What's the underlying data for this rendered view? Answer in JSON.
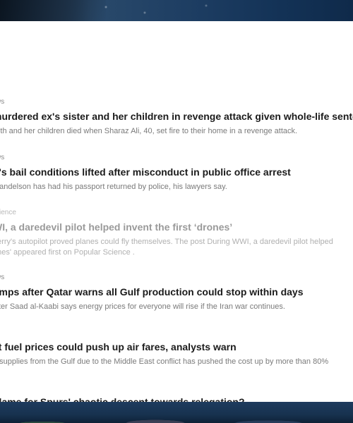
{
  "feed": {
    "items": [
      {
        "source": "ws",
        "title": "murdered ex's sister and her children in revenge attack given whole-life sentence",
        "summary": "with and her children died when Sharaz Ali, 40, set fire to their home in a revenge attack."
      },
      {
        "source": "ws",
        "title": "n's bail conditions lifted after misconduct in public office arrest",
        "summary": "Mandelson has had his passport returned by police, his lawyers say."
      },
      {
        "source": "cience",
        "title": "WI, a daredevil pilot helped invent the first ‘drones’",
        "summary": "perry's autopilot proved planes could fly themselves. The post During WWI, a daredevil pilot helped",
        "summary_line2": "ones' appeared first on Popular Science ."
      },
      {
        "source": "ws",
        "title": "umps after Qatar warns all Gulf production could stop within days",
        "summary": "ister Saad al-Kaabi says energy prices for everyone will rise if the Iran war continues."
      },
      {
        "source": "s",
        "title": "et fuel prices could push up air fares, analysts warn",
        "summary": "o supplies from the Gulf due to the Middle East conflict has pushed the cost up by more than 80%"
      },
      {
        "source": "s",
        "title": "blame for Spurs' chaotic descent towards relegation?"
      }
    ]
  }
}
